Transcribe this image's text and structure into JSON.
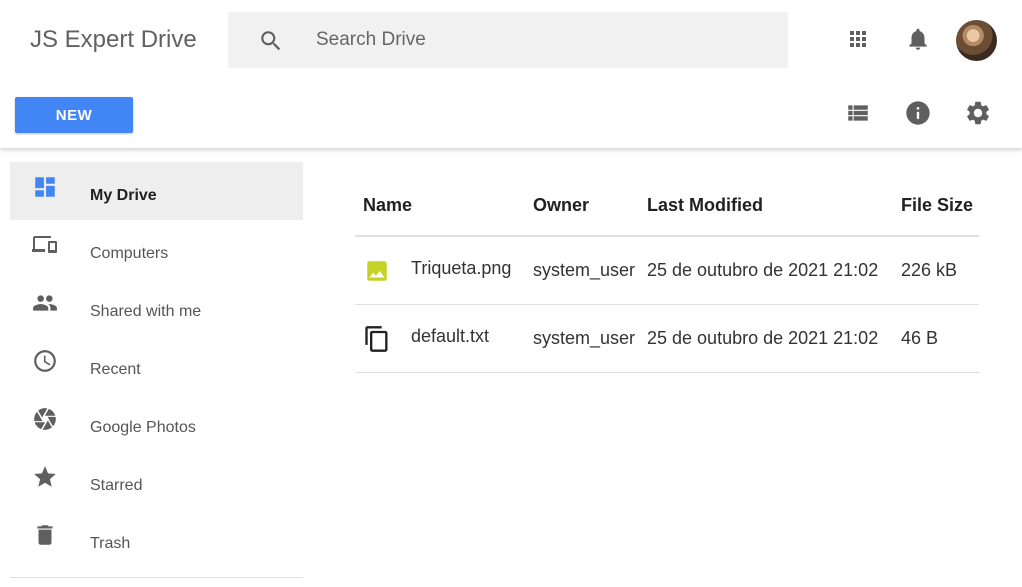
{
  "app": {
    "title": "JS Expert Drive"
  },
  "search": {
    "placeholder": "Search Drive",
    "icon": "search-icon"
  },
  "header_icons": [
    "apps-grid-icon",
    "notifications-bell-icon",
    "avatar"
  ],
  "toolbar": {
    "new_label": "NEW",
    "icons": [
      "list-view-icon",
      "info-icon",
      "settings-gear-icon"
    ]
  },
  "colors": {
    "accent": "#4285f4",
    "image_file": "#c6d225",
    "icon_gray": "#5f5f5f"
  },
  "sidebar": {
    "items": [
      {
        "label": "My Drive",
        "icon": "my-drive-icon",
        "active": true
      },
      {
        "label": "Computers",
        "icon": "computers-icon"
      },
      {
        "label": "Shared with me",
        "icon": "shared-with-me-icon"
      },
      {
        "label": "Recent",
        "icon": "recent-clock-icon"
      },
      {
        "label": "Google Photos",
        "icon": "google-photos-icon"
      },
      {
        "label": "Starred",
        "icon": "star-icon"
      },
      {
        "label": "Trash",
        "icon": "trash-icon"
      }
    ]
  },
  "table": {
    "columns": [
      "Name",
      "Owner",
      "Last Modified",
      "File Size"
    ],
    "rows": [
      {
        "name": "Triqueta.png",
        "icon": "image-file-icon",
        "owner": "system_user",
        "modified": "25 de outubro de 2021 21:02",
        "size": "226 kB"
      },
      {
        "name": "default.txt",
        "icon": "copy-document-icon",
        "owner": "system_user",
        "modified": "25 de outubro de 2021 21:02",
        "size": "46 B"
      }
    ]
  }
}
